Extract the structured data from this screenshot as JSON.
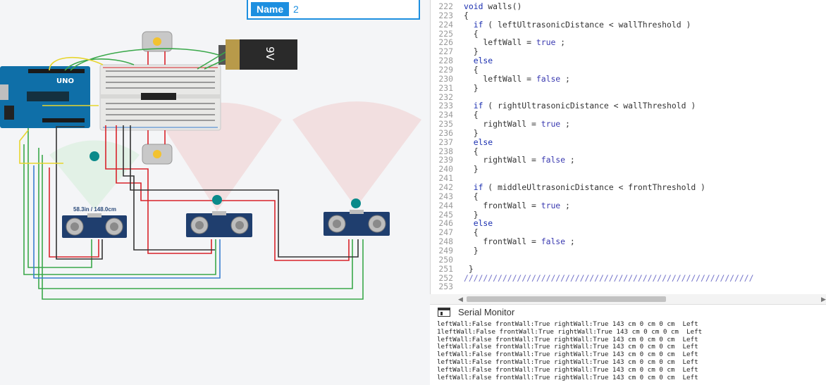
{
  "name_field": {
    "label": "Name",
    "value": "2"
  },
  "distance_readout": "58.3in / 148.0cm",
  "battery_label": "9V",
  "arduino_label": "UNO",
  "code_lines": [
    {
      "ln": "222",
      "segs": [
        {
          "t": "void ",
          "c": "kw"
        },
        {
          "t": "walls()",
          "c": ""
        }
      ]
    },
    {
      "ln": "223",
      "segs": [
        {
          "t": "{",
          "c": ""
        }
      ]
    },
    {
      "ln": "224",
      "segs": [
        {
          "t": "  ",
          "c": ""
        },
        {
          "t": "if",
          "c": "kw"
        },
        {
          "t": " ( leftUltrasonicDistance < wallThreshold )",
          "c": ""
        }
      ]
    },
    {
      "ln": "225",
      "segs": [
        {
          "t": "  {",
          "c": ""
        }
      ]
    },
    {
      "ln": "226",
      "segs": [
        {
          "t": "    leftWall = ",
          "c": ""
        },
        {
          "t": "true",
          "c": "bl"
        },
        {
          "t": " ;",
          "c": ""
        }
      ]
    },
    {
      "ln": "227",
      "segs": [
        {
          "t": "  }",
          "c": ""
        }
      ]
    },
    {
      "ln": "228",
      "segs": [
        {
          "t": "  ",
          "c": ""
        },
        {
          "t": "else",
          "c": "kw"
        }
      ]
    },
    {
      "ln": "229",
      "segs": [
        {
          "t": "  {",
          "c": ""
        }
      ]
    },
    {
      "ln": "230",
      "segs": [
        {
          "t": "    leftWall = ",
          "c": ""
        },
        {
          "t": "false",
          "c": "bl"
        },
        {
          "t": " ;",
          "c": ""
        }
      ]
    },
    {
      "ln": "231",
      "segs": [
        {
          "t": "  }",
          "c": ""
        }
      ]
    },
    {
      "ln": "232",
      "segs": [
        {
          "t": "",
          "c": ""
        }
      ]
    },
    {
      "ln": "233",
      "segs": [
        {
          "t": "  ",
          "c": ""
        },
        {
          "t": "if",
          "c": "kw"
        },
        {
          "t": " ( rightUltrasonicDistance < wallThreshold )",
          "c": ""
        }
      ]
    },
    {
      "ln": "234",
      "segs": [
        {
          "t": "  {",
          "c": ""
        }
      ]
    },
    {
      "ln": "235",
      "segs": [
        {
          "t": "    rightWall = ",
          "c": ""
        },
        {
          "t": "true",
          "c": "bl"
        },
        {
          "t": " ;",
          "c": ""
        }
      ]
    },
    {
      "ln": "236",
      "segs": [
        {
          "t": "  }",
          "c": ""
        }
      ]
    },
    {
      "ln": "237",
      "segs": [
        {
          "t": "  ",
          "c": ""
        },
        {
          "t": "else",
          "c": "kw"
        }
      ]
    },
    {
      "ln": "238",
      "segs": [
        {
          "t": "  {",
          "c": ""
        }
      ]
    },
    {
      "ln": "239",
      "segs": [
        {
          "t": "    rightWall = ",
          "c": ""
        },
        {
          "t": "false",
          "c": "bl"
        },
        {
          "t": " ;",
          "c": ""
        }
      ]
    },
    {
      "ln": "240",
      "segs": [
        {
          "t": "  }",
          "c": ""
        }
      ]
    },
    {
      "ln": "241",
      "segs": [
        {
          "t": "",
          "c": ""
        }
      ]
    },
    {
      "ln": "242",
      "segs": [
        {
          "t": "  ",
          "c": ""
        },
        {
          "t": "if",
          "c": "kw"
        },
        {
          "t": " ( middleUltrasonicDistance < frontThreshold )",
          "c": ""
        }
      ]
    },
    {
      "ln": "243",
      "segs": [
        {
          "t": "  {",
          "c": ""
        }
      ]
    },
    {
      "ln": "244",
      "segs": [
        {
          "t": "    frontWall = ",
          "c": ""
        },
        {
          "t": "true",
          "c": "bl"
        },
        {
          "t": " ;",
          "c": ""
        }
      ]
    },
    {
      "ln": "245",
      "segs": [
        {
          "t": "  }",
          "c": ""
        }
      ]
    },
    {
      "ln": "246",
      "segs": [
        {
          "t": "  ",
          "c": ""
        },
        {
          "t": "else",
          "c": "kw"
        }
      ]
    },
    {
      "ln": "247",
      "segs": [
        {
          "t": "  {",
          "c": ""
        }
      ]
    },
    {
      "ln": "248",
      "segs": [
        {
          "t": "    frontWall = ",
          "c": ""
        },
        {
          "t": "false",
          "c": "bl"
        },
        {
          "t": " ;",
          "c": ""
        }
      ]
    },
    {
      "ln": "249",
      "segs": [
        {
          "t": "  }",
          "c": ""
        }
      ]
    },
    {
      "ln": "250",
      "segs": [
        {
          "t": "",
          "c": ""
        }
      ]
    },
    {
      "ln": "251",
      "segs": [
        {
          "t": " }",
          "c": ""
        }
      ]
    },
    {
      "ln": "252",
      "segs": [
        {
          "t": "////////////////////////////////////////////////////////////",
          "c": "cm"
        }
      ]
    },
    {
      "ln": "253",
      "segs": [
        {
          "t": "",
          "c": ""
        }
      ]
    }
  ],
  "serial_monitor": {
    "title": "Serial Monitor",
    "lines": [
      "leftWall:False frontWall:True rightWall:True 143 cm 0 cm 0 cm  Left",
      "1leftWall:False frontWall:True rightWall:True 143 cm 0 cm 0 cm  Left",
      "leftWall:False frontWall:True rightWall:True 143 cm 0 cm 0 cm  Left",
      "leftWall:False frontWall:True rightWall:True 143 cm 0 cm 0 cm  Left",
      "leftWall:False frontWall:True rightWall:True 143 cm 0 cm 0 cm  Left",
      "leftWall:False frontWall:True rightWall:True 143 cm 0 cm 0 cm  Left",
      "leftWall:False frontWall:True rightWall:True 143 cm 0 cm 0 cm  Left",
      "leftWall:False frontWall:True rightWall:True 143 cm 0 cm 0 cm  Left"
    ]
  },
  "colors": {
    "accent": "#1d8fe0",
    "arduino": "#0f6fa8",
    "wire_red": "#d8232a",
    "wire_green": "#3aa84a",
    "wire_blue": "#3a7fd0",
    "wire_dark": "#333333",
    "sensor": "#1f3e6e",
    "probe": "#0a8a8a"
  }
}
